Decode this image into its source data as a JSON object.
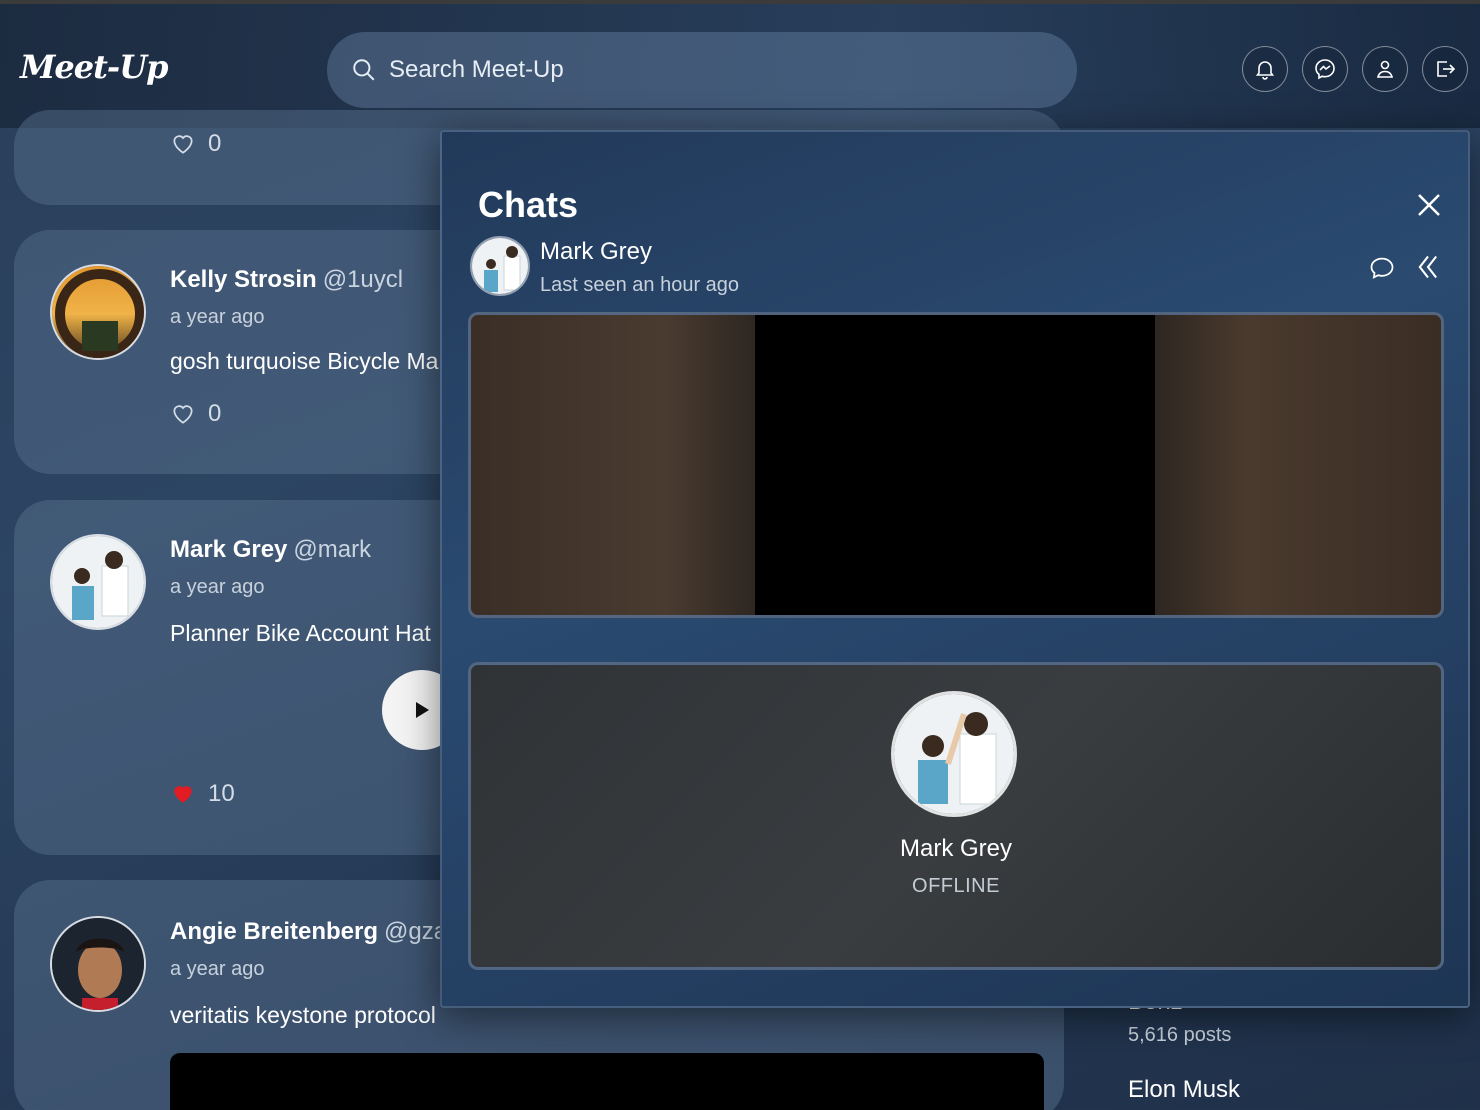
{
  "app": {
    "logo": "Meet-Up"
  },
  "search": {
    "placeholder": "Search Meet-Up"
  },
  "top_icons": [
    "bell-icon",
    "messenger-icon",
    "user-icon",
    "logout-icon"
  ],
  "feed": {
    "first_card_likes": "0",
    "posts": [
      {
        "name": "Kelly Strosin",
        "handle": "@1uycl",
        "time": "a year ago",
        "text": "gosh turquoise Bicycle Ma",
        "likes": "0",
        "liked": false
      },
      {
        "name": "Mark Grey",
        "handle": "@mark",
        "time": "a year ago",
        "text": "Planner Bike Account Hat",
        "likes": "10",
        "liked": true
      },
      {
        "name": "Angie Breitenberg",
        "handle": "@gza",
        "time": "a year ago",
        "text": "veritatis keystone protocol"
      }
    ]
  },
  "sidebar": {
    "partial_name": "Benz",
    "posts_count": "5,616 posts",
    "next_name": "Elon Musk"
  },
  "chats": {
    "title": "Chats",
    "contact_name": "Mark Grey",
    "contact_status": "Last seen an hour ago",
    "local_name": "Mark Grey",
    "local_status": "OFFLINE"
  },
  "colors": {
    "like_red": "#e31b23",
    "background": "#2c4563"
  }
}
